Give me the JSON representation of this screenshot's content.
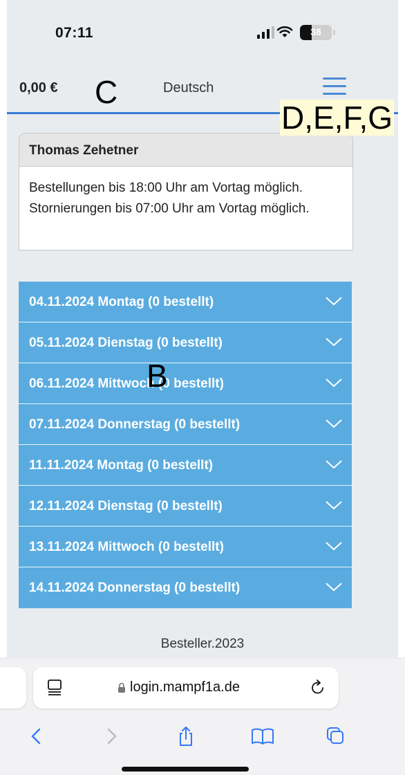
{
  "status_bar": {
    "time": "07:11",
    "battery": "38",
    "battery_level": 0.38
  },
  "header": {
    "balance": "0,00 €",
    "language": "Deutsch"
  },
  "annotations": {
    "c": "C",
    "b": "B",
    "menu": "D,E,F,G"
  },
  "info_card": {
    "name": "Thomas Zehetner",
    "text": "Bestellungen bis 18:00 Uhr am Vortag möglich. Stornierungen bis 07:00 Uhr am Vortag möglich."
  },
  "days": [
    {
      "label": "04.11.2024 Montag (0 bestellt)"
    },
    {
      "label": "05.11.2024 Dienstag (0 bestellt)"
    },
    {
      "label": "06.11.2024 Mittwoch (0 bestellt)"
    },
    {
      "label": "07.11.2024 Donnerstag (0 bestellt)"
    },
    {
      "label": "11.11.2024 Montag (0 bestellt)"
    },
    {
      "label": "12.11.2024 Dienstag (0 bestellt)"
    },
    {
      "label": "13.11.2024 Mittwoch (0 bestellt)"
    },
    {
      "label": "14.11.2024 Donnerstag (0 bestellt)"
    }
  ],
  "footer": {
    "text": "Besteller.2023"
  },
  "browser": {
    "url": "login.mampf1a.de"
  },
  "colors": {
    "accent": "#5aace0",
    "nav_line": "#3a7bd5",
    "link_blue": "#3478f6"
  }
}
